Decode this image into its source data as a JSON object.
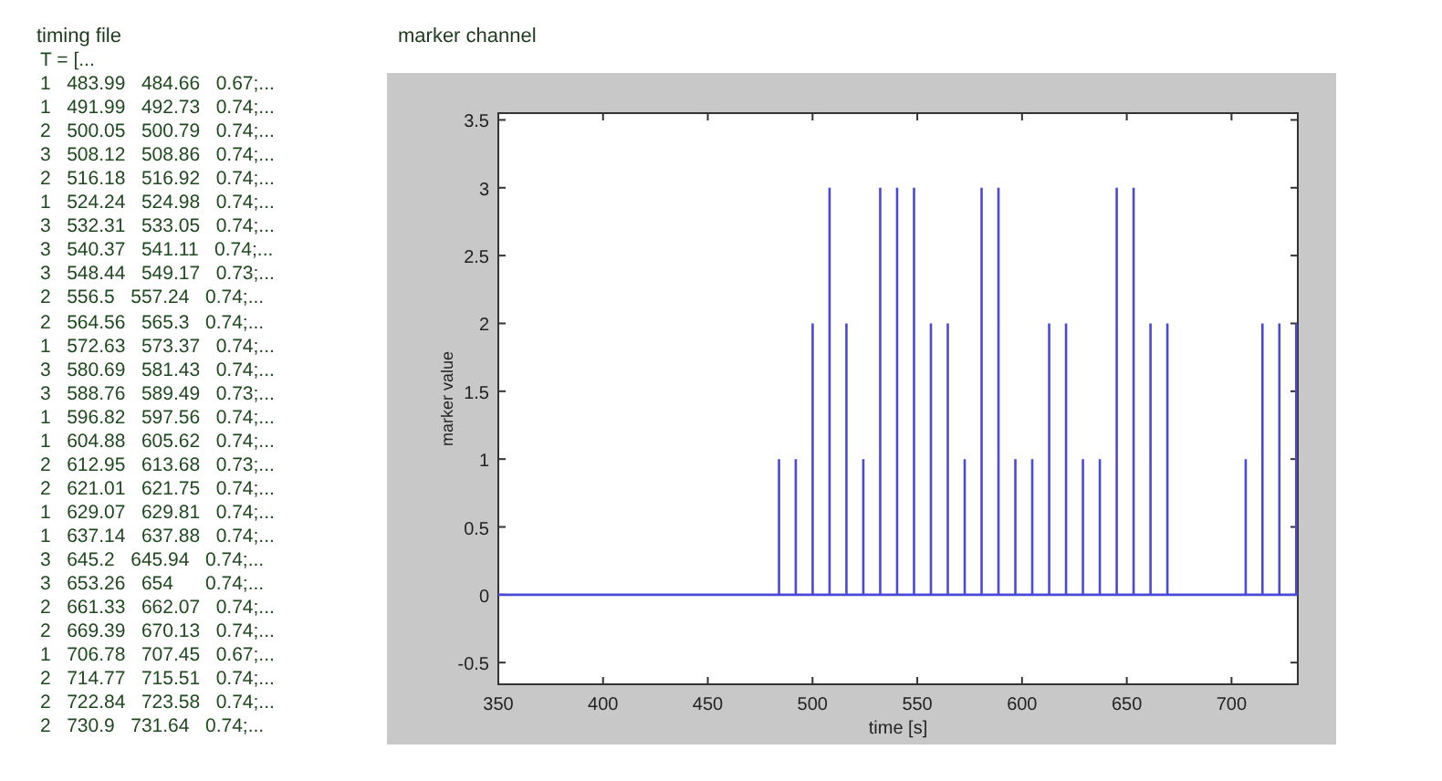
{
  "timing_file": {
    "title": "timing file",
    "header": "T = [...",
    "rows": [
      "1   483.99   484.66   0.67;...",
      "1   491.99   492.73   0.74;...",
      "2   500.05   500.79   0.74;...",
      "3   508.12   508.86   0.74;...",
      "2   516.18   516.92   0.74;...",
      "1   524.24   524.98   0.74;...",
      "3   532.31   533.05   0.74;...",
      "3   540.37   541.11   0.74;...",
      "3   548.44   549.17   0.73;...",
      "2   556.5   557.24   0.74;...",
      "2   564.56   565.3   0.74;...",
      "1   572.63   573.37   0.74;...",
      "3   580.69   581.43   0.74;...",
      "3   588.76   589.49   0.73;...",
      "1   596.82   597.56   0.74;...",
      "1   604.88   605.62   0.74;...",
      "2   612.95   613.68   0.73;...",
      "2   621.01   621.75   0.74;...",
      "1   629.07   629.81   0.74;...",
      "1   637.14   637.88   0.74;...",
      "3   645.2   645.94   0.74;...",
      "3   653.26   654      0.74;...",
      "2   661.33   662.07   0.74;...",
      "2   669.39   670.13   0.74;...",
      "1   706.78   707.45   0.67;...",
      "2   714.77   715.51   0.74;...",
      "2   722.84   723.58   0.74;...",
      "2   730.9   731.64   0.74;..."
    ]
  },
  "marker_channel": {
    "title": "marker channel",
    "chart_data": {
      "type": "line",
      "xlabel": "time [s]",
      "ylabel": "marker value",
      "x": [
        350,
        483.99,
        483.99,
        483.99,
        491.99,
        491.99,
        491.99,
        500.05,
        500.05,
        500.05,
        508.12,
        508.12,
        508.12,
        516.18,
        516.18,
        516.18,
        524.24,
        524.24,
        524.24,
        532.31,
        532.31,
        532.31,
        540.37,
        540.37,
        540.37,
        548.44,
        548.44,
        548.44,
        556.5,
        556.5,
        556.5,
        564.56,
        564.56,
        564.56,
        572.63,
        572.63,
        572.63,
        580.69,
        580.69,
        580.69,
        588.76,
        588.76,
        588.76,
        596.82,
        596.82,
        596.82,
        604.88,
        604.88,
        604.88,
        612.95,
        612.95,
        612.95,
        621.01,
        621.01,
        621.01,
        629.07,
        629.07,
        629.07,
        637.14,
        637.14,
        637.14,
        645.2,
        645.2,
        645.2,
        653.26,
        653.26,
        653.26,
        661.33,
        661.33,
        661.33,
        669.39,
        669.39,
        669.39,
        706.78,
        706.78,
        706.78,
        714.77,
        714.77,
        714.77,
        722.84,
        722.84,
        722.84,
        730.9,
        730.9,
        730.9,
        731.64
      ],
      "series": [
        {
          "color": "#4a4ad8",
          "values": [
            0,
            0,
            1,
            0,
            0,
            1,
            0,
            0,
            2,
            0,
            0,
            3,
            0,
            0,
            2,
            0,
            0,
            1,
            0,
            0,
            3,
            0,
            0,
            3,
            0,
            0,
            3,
            0,
            0,
            2,
            0,
            0,
            2,
            0,
            0,
            1,
            0,
            0,
            3,
            0,
            0,
            3,
            0,
            0,
            1,
            0,
            0,
            1,
            0,
            0,
            2,
            0,
            0,
            2,
            0,
            0,
            1,
            0,
            0,
            1,
            0,
            0,
            3,
            0,
            0,
            3,
            0,
            0,
            2,
            0,
            0,
            2,
            0,
            0,
            1,
            0,
            0,
            2,
            0,
            0,
            2,
            0,
            0,
            2,
            0,
            0
          ]
        }
      ],
      "xlim": [
        350,
        731.64
      ],
      "ylim": [
        -0.66,
        3.55
      ],
      "xticks": [
        350,
        400,
        450,
        500,
        550,
        600,
        650,
        700
      ],
      "yticks": [
        -0.5,
        0,
        0.5,
        1,
        1.5,
        2,
        2.5,
        3,
        3.5
      ]
    }
  }
}
